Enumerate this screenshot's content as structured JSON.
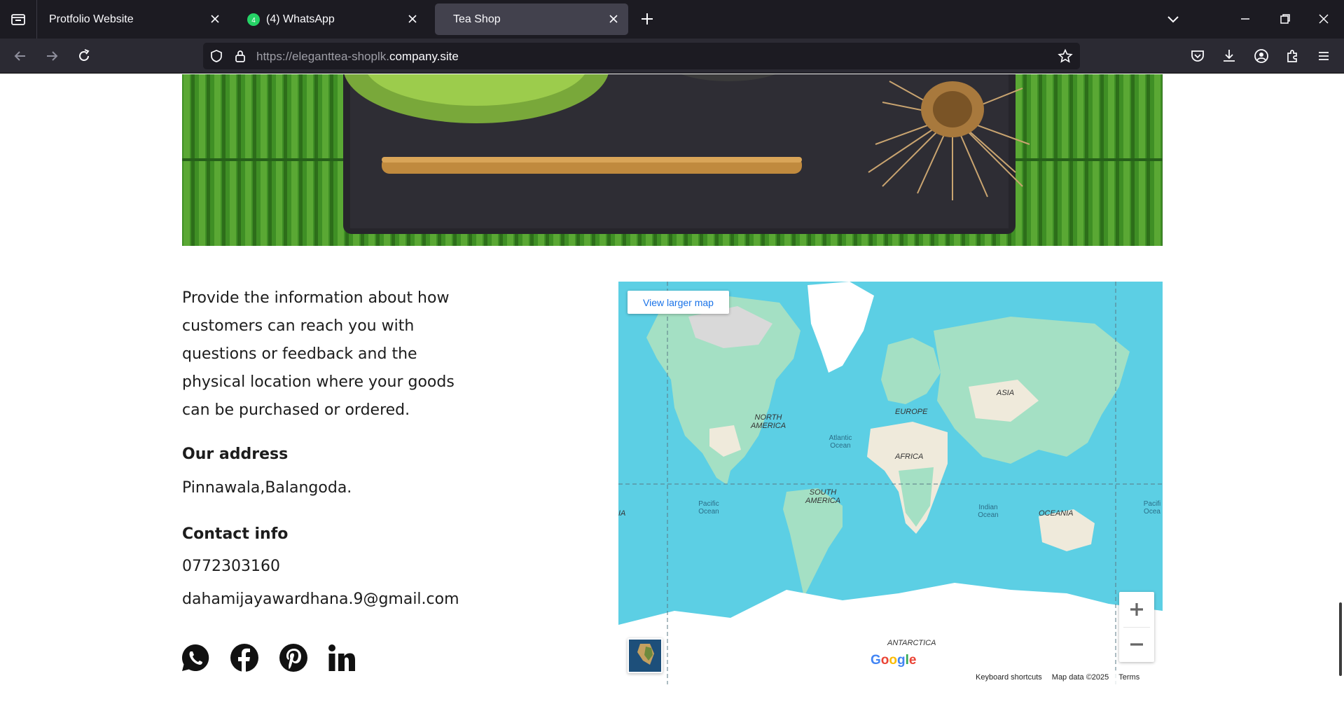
{
  "browser": {
    "tabs": [
      {
        "label": "Protfolio Website"
      },
      {
        "label": "(4) WhatsApp",
        "badge": "4"
      },
      {
        "label": "Tea Shop"
      }
    ],
    "url": {
      "prefix": "https://eleganttea-shoplk.",
      "domain": "company.site"
    }
  },
  "contact": {
    "intro": "Provide the information about how customers can reach you with questions or feedback and the physical location where your goods can be purchased or ordered.",
    "address_heading": "Our address",
    "address": "Pinnawala,Balangoda.",
    "contact_heading": "Contact info",
    "phone": "0772303160",
    "email": "dahamijayawardhana.9@gmail.com",
    "social_icons": [
      "whatsapp-icon",
      "facebook-icon",
      "pinterest-icon",
      "linkedin-icon"
    ]
  },
  "map": {
    "view_larger": "View larger map",
    "labels": {
      "north_america": "NORTH AMERICA",
      "south_america": "SOUTH AMERICA",
      "europe": "EUROPE",
      "asia": "ASIA",
      "africa": "AFRICA",
      "oceania": "OCEANIA",
      "antarctica": "ANTARCTICA",
      "ia": "IA",
      "atlantic": "Atlantic Ocean",
      "pacific": "Pacific Ocean",
      "indian": "Indian Ocean",
      "pacific_right": "Pacifi Ocea"
    },
    "brand": "Google",
    "footer": {
      "shortcuts": "Keyboard shortcuts",
      "data": "Map data ©2025",
      "terms": "Terms"
    },
    "zoom_in": "+",
    "zoom_out": "−"
  },
  "colors": {
    "ocean": "#5ccfe4",
    "land": "#9ee0c0",
    "chrome_dark": "#1c1b22",
    "chrome_nav": "#2b2a33"
  }
}
